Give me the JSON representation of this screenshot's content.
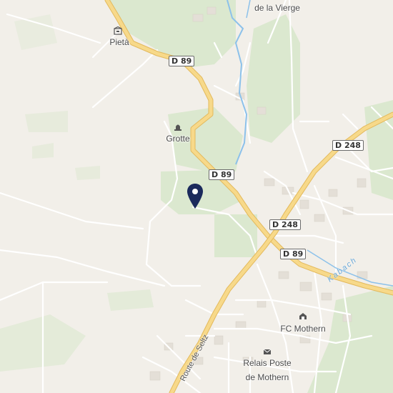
{
  "map": {
    "places": [
      {
        "id": "vierge",
        "text": "de la Vierge"
      },
      {
        "id": "pieta",
        "text": "Pietà"
      },
      {
        "id": "grotte",
        "text": "Grotte"
      },
      {
        "id": "fc",
        "text": "FC Mothern"
      },
      {
        "id": "relais1",
        "text": "Relais Poste"
      },
      {
        "id": "relais2",
        "text": "de Mothern"
      }
    ],
    "roads": {
      "d89_a": "D 89",
      "d89_b": "D 89",
      "d89_c": "D 89",
      "d248_a": "D 248",
      "d248_b": "D 248"
    },
    "street": "Route de Seltz",
    "water": "Kabach",
    "colors": {
      "background": "#f2efe9",
      "green": "#dbe8cf",
      "main_road": "#f7d98a",
      "road_casing": "#e3b95c",
      "water": "#8cc1ea",
      "marker": "#1b2a5c"
    },
    "marker_icon": "location-pin-icon"
  }
}
